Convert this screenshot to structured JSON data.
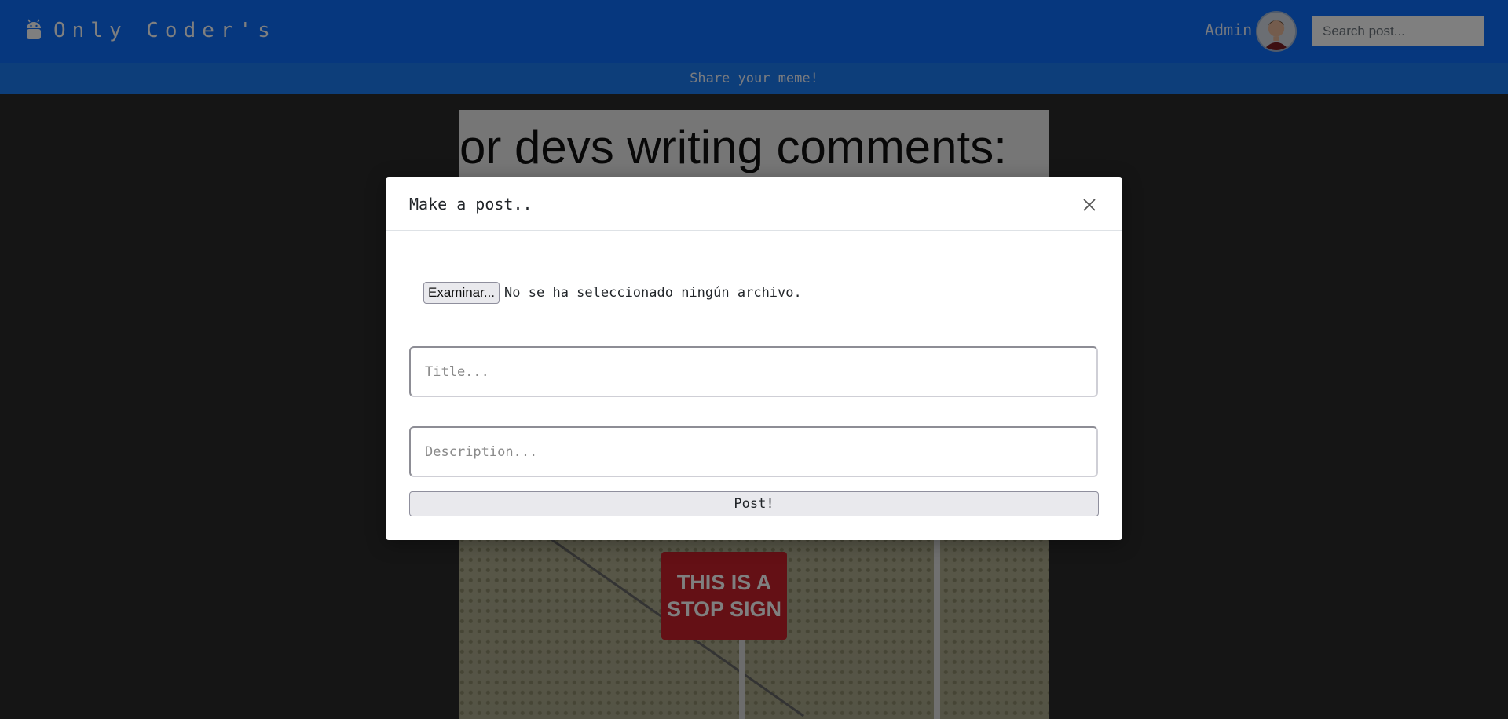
{
  "navbar": {
    "brand": "Only Coder's",
    "brand_icon": "android-icon",
    "user_name": "Admin",
    "search_placeholder": "Search post..."
  },
  "sharebar": {
    "link": "Share your meme!"
  },
  "background_post": {
    "caption": "or devs writing comments:",
    "sign_line1": "THIS IS A",
    "sign_line2": "STOP SIGN"
  },
  "modal": {
    "title": "Make a post..",
    "close_icon": "close-icon",
    "file_button": "Examinar...",
    "file_status": "No se ha seleccionado ningún archivo.",
    "title_placeholder": "Title...",
    "description_placeholder": "Description...",
    "submit_label": "Post!"
  },
  "colors": {
    "navbar": "#0d6efd",
    "sharebar": "#1a7cf5",
    "page_background": "#2b2b2b",
    "backdrop": "rgba(0,0,0,0.5)"
  }
}
